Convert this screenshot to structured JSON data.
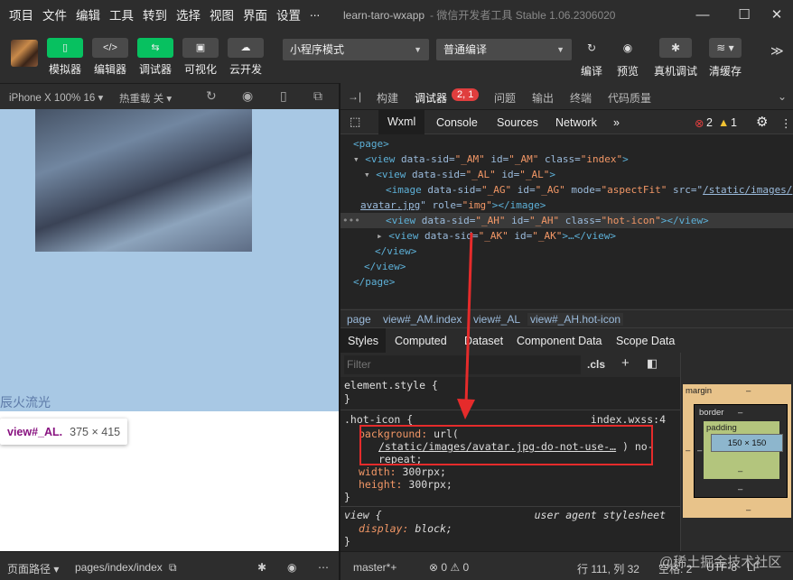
{
  "menu": [
    "项目",
    "文件",
    "编辑",
    "工具",
    "转到",
    "选择",
    "视图",
    "界面",
    "设置",
    "..."
  ],
  "window": {
    "title": "learn-taro-wxapp",
    "subtitle": "- 微信开发者工具 Stable 1.06.2306020"
  },
  "toolbar": {
    "buttons": [
      {
        "label": "模拟器",
        "glyph": "▯"
      },
      {
        "label": "编辑器",
        "glyph": "</>"
      },
      {
        "label": "调试器",
        "glyph": "⇆"
      },
      {
        "label": "可视化",
        "glyph": "▣"
      },
      {
        "label": "云开发",
        "glyph": "☁"
      }
    ],
    "mode_select": "小程序模式",
    "compile_select": "普通编译",
    "right": [
      {
        "label": "编译",
        "glyph": "↻"
      },
      {
        "label": "预览",
        "glyph": "◉"
      },
      {
        "label": "真机调试",
        "glyph": "✱"
      },
      {
        "label": "清缓存",
        "glyph": "≋ ▾"
      }
    ]
  },
  "sim": {
    "device": "iPhone X 100% 16 ▾",
    "reload": "热重载 关 ▾",
    "caption": "辰火流光",
    "tooltip": {
      "name": "view#_AL.",
      "size": "375 × 415"
    },
    "footer": {
      "path_label": "页面路径 ▾",
      "path": "pages/index/index"
    }
  },
  "devtools": {
    "tabs": [
      "构建",
      "调试器",
      "问题",
      "输出",
      "终端",
      "代码质量"
    ],
    "badge": "2, 1",
    "subtabs": [
      "Wxml",
      "Console",
      "Sources",
      "Network",
      "»"
    ],
    "errors": "2",
    "warnings": "1",
    "breadcrumb": [
      "page",
      "view#_AM.index",
      "view#_AL",
      "view#_AH.hot-icon"
    ],
    "style_tabs": [
      "Styles",
      "Computed",
      "Dataset",
      "Component Data",
      "Scope Data"
    ],
    "filter_placeholder": "Filter",
    "cls": ".cls",
    "wxml": {
      "l1": "<page>",
      "l2a": "▾",
      "l2b": "<view",
      "l2c": " data-sid=",
      "l2d": "\"_AM\"",
      "l2e": " id=",
      "l2f": "\"_AM\"",
      "l2g": " class=",
      "l2h": "\"index\"",
      "l2i": ">",
      "l3a": "▾",
      "l3b": "<view",
      "l3c": " data-sid=",
      "l3d": "\"_AL\"",
      "l3e": " id=",
      "l3f": "\"_AL\"",
      "l3g": ">",
      "l4a": "<image",
      "l4b": " data-sid=",
      "l4c": "\"_AG\"",
      "l4d": " id=",
      "l4e": "\"_AG\"",
      "l4f": " mode=",
      "l4g": "\"aspectFit\"",
      "l4h": " src=\"",
      "l4i": "/static/images/",
      "l5a": "avatar.jpg",
      "l5b": "\" role=",
      "l5c": "\"img\"",
      "l5d": "></image>",
      "l6a": "<view",
      "l6b": " data-sid=",
      "l6c": "\"_AH\"",
      "l6d": " id=",
      "l6e": "\"_AH\"",
      "l6f": " class=",
      "l6g": "\"hot-icon\"",
      "l6h": "></view>",
      "l7a": "▸",
      "l7b": "<view",
      "l7c": " data-sid=",
      "l7d": "\"_AK\"",
      "l7e": " id=",
      "l7f": "\"_AK\"",
      "l7g": ">…</view>",
      "l8": "</view>",
      "l9": "</view>",
      "l10": "</page>",
      "dots": "•••"
    },
    "styles": {
      "element_style": "element.style {",
      "close": "}",
      "rule": ".hot-icon {",
      "source": "index.wxss:4",
      "bg_prop": "background:",
      "bg_val": " url(",
      "bg_url": "/static/images/avatar.jpg-do-not-use-…",
      "bg_tail": " ) no-",
      "bg_tail2": "repeat;",
      "w_prop": "width:",
      "w_val": " 300rpx;",
      "h_prop": "height:",
      "h_val": " 300rpx;",
      "ua_rule": "view {",
      "ua_source": "user agent stylesheet",
      "d_prop": "display:",
      "d_val": " block;"
    },
    "box_model": {
      "margin": "margin",
      "border": "border",
      "padding": "padding",
      "content": "150 × 150",
      "dash": "–"
    }
  },
  "status": {
    "branch": "master*+",
    "errs": "⊗ 0 ⚠ 0",
    "position": "行 111, 列 32",
    "indent": "空格: 2",
    "encoding": "UTF-8",
    "eol": "LF"
  },
  "watermark": "@稀土掘金技术社区",
  "colors": {
    "accent_green": "#07c160",
    "highlight_red": "#e52b2b",
    "tag_blue": "#5db0d7",
    "attr_orange": "#f29766"
  }
}
